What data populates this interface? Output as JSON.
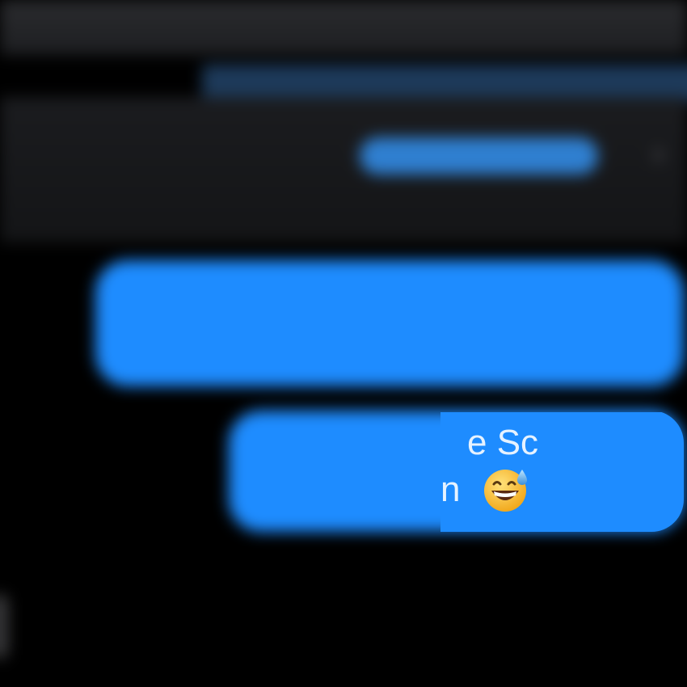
{
  "topbar": {
    "title": ""
  },
  "header": {
    "line1": "",
    "line2": "",
    "button_label": "",
    "chevron_icon": "chevron-right-icon"
  },
  "messages": [
    {
      "text": "",
      "sender": "me"
    },
    {
      "text_line1": "e Sc",
      "text_line2": "n",
      "emoji": "grinning-face-with-sweat",
      "sender": "me"
    }
  ],
  "read_receipt": "",
  "colors": {
    "bubble": "#1e8cff",
    "background": "#000000",
    "accent": "#2f7fd0"
  }
}
